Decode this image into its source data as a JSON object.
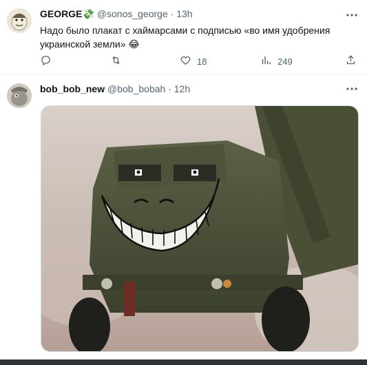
{
  "tweets": [
    {
      "display_name": "GEORGE💸",
      "handle": "@sonos_george",
      "separator": "·",
      "time": "13h",
      "text": "Надо было плакат с хаймарсами с подписью «во имя удобрения украинской земли» 😂",
      "likes": "18",
      "views": "249"
    },
    {
      "display_name": "bob_bob_new",
      "handle": "@bob_bobah",
      "separator": "·",
      "time": "12h"
    }
  ],
  "icons": {
    "reply": "reply-icon",
    "retweet": "retweet-icon",
    "like": "heart-icon",
    "views": "views-icon",
    "share": "share-icon",
    "more": "more-icon"
  }
}
